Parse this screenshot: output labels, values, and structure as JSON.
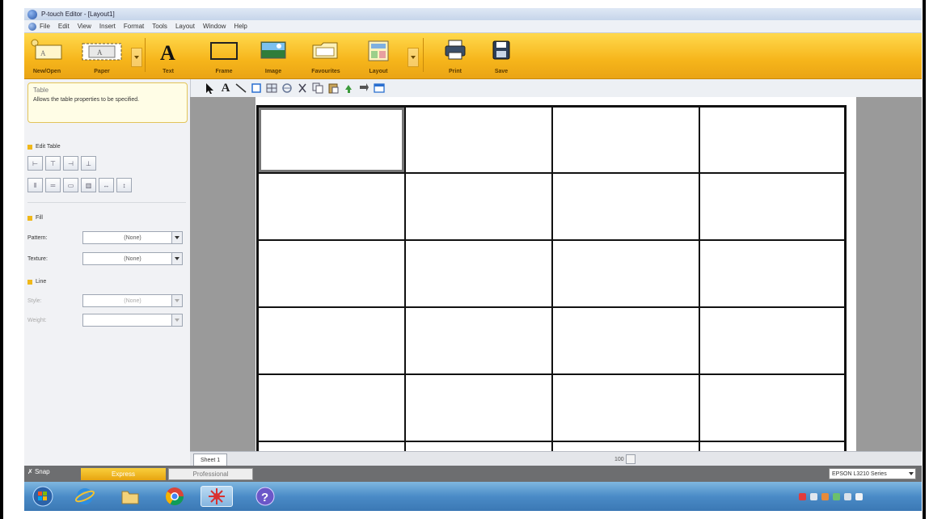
{
  "window": {
    "title": "P-touch Editor - [Layout1]"
  },
  "menu": [
    "File",
    "Edit",
    "View",
    "Insert",
    "Format",
    "Tools",
    "Layout",
    "Window",
    "Help"
  ],
  "ribbon": {
    "new_open": "New/Open",
    "paper": "Paper",
    "text": "Text",
    "frame": "Frame",
    "image": "Image",
    "favourites": "Favourites",
    "layout": "Layout",
    "print": "Print",
    "save": "Save"
  },
  "panel": {
    "tip_title": "Table",
    "tip_body": "Allows the table properties to be specified.",
    "edit_table": "Edit Table",
    "fill": "Fill",
    "pattern_label": "Pattern:",
    "pattern_value": "(None)",
    "texture_label": "Texture:",
    "texture_value": "(None)",
    "line": "Line",
    "style_label": "Style:",
    "style_value": "(None)",
    "weight_label": "Weight:",
    "weight_value": ""
  },
  "sheet_tab": "Sheet 1",
  "zoom": "100",
  "modes": {
    "snap": "Snap",
    "express": "Express",
    "professional": "Professional"
  },
  "printer": "EPSON L3210 Series",
  "colors": {
    "ribbon": "#f6b51b",
    "express": "#e7a40f"
  }
}
